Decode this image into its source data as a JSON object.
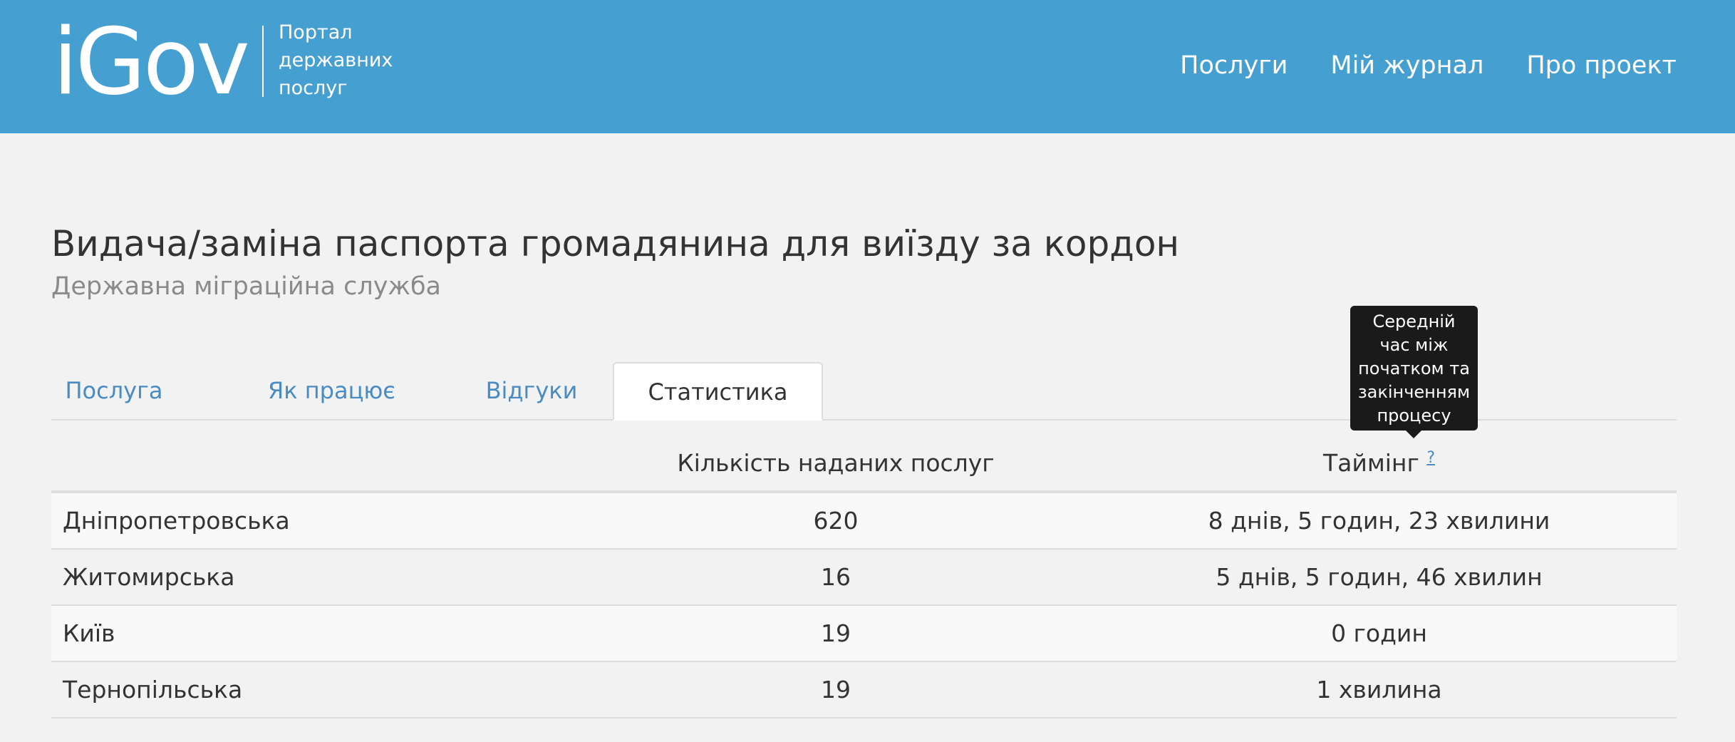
{
  "header": {
    "logo": "iGov",
    "tagline": [
      "Портал",
      "державних",
      "послуг"
    ],
    "nav": [
      "Послуги",
      "Мій журнал",
      "Про проект"
    ]
  },
  "page": {
    "title": "Видача/заміна паспорта громадянина для виїзду за кордон",
    "subtitle": "Державна міграційна служба"
  },
  "tabs": [
    {
      "label": "Послуга",
      "active": false
    },
    {
      "label": "Як працює",
      "active": false
    },
    {
      "label": "Відгуки",
      "active": false
    },
    {
      "label": "Статистика",
      "active": true
    }
  ],
  "table": {
    "headers": {
      "region": "",
      "count": "Кількість наданих послуг",
      "timing": "Таймінг",
      "timing_help": "?"
    },
    "rows": [
      {
        "region": "Дніпропетровська",
        "count": "620",
        "timing": "8 днів, 5 годин, 23 хвилини"
      },
      {
        "region": "Житомирська",
        "count": "16",
        "timing": "5 днів, 5 годин, 46 хвилин"
      },
      {
        "region": "Київ",
        "count": "19",
        "timing": "0 годин"
      },
      {
        "region": "Тернопільська",
        "count": "19",
        "timing": "1 хвилина"
      }
    ]
  },
  "tooltip": {
    "lines": [
      "Середній",
      "час між",
      "початком та",
      "закінченням",
      "процесу"
    ]
  },
  "colors": {
    "header_bg": "#459fd1",
    "page_bg": "#f2f2f2",
    "link": "#4a8bc4",
    "tooltip_bg": "#1a1a1a"
  }
}
